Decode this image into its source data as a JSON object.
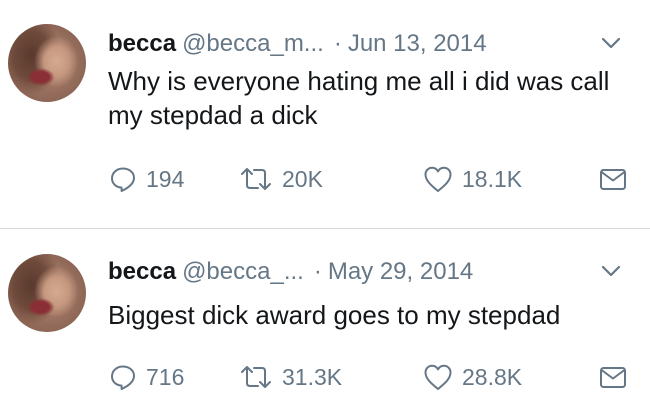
{
  "tweets": [
    {
      "user_name": "becca",
      "handle": "@becca_m...",
      "separator": "·",
      "date": "Jun 13, 2014",
      "text": "Why is everyone hating me all i did was call my stepdad a dick",
      "replies": "194",
      "retweets": "20K",
      "likes": "18.1K"
    },
    {
      "user_name": "becca",
      "handle": "@becca_...",
      "separator": "·",
      "date": "May 29, 2014",
      "text": "Biggest dick award goes to my stepdad",
      "replies": "716",
      "retweets": "31.3K",
      "likes": "28.8K"
    }
  ],
  "icons": {
    "reply": "reply-icon",
    "retweet": "retweet-icon",
    "like": "heart-icon",
    "dm": "envelope-icon",
    "menu": "chevron-down-icon"
  },
  "colors": {
    "text": "#14171a",
    "secondary": "#657786",
    "divider": "#d6dadd"
  }
}
